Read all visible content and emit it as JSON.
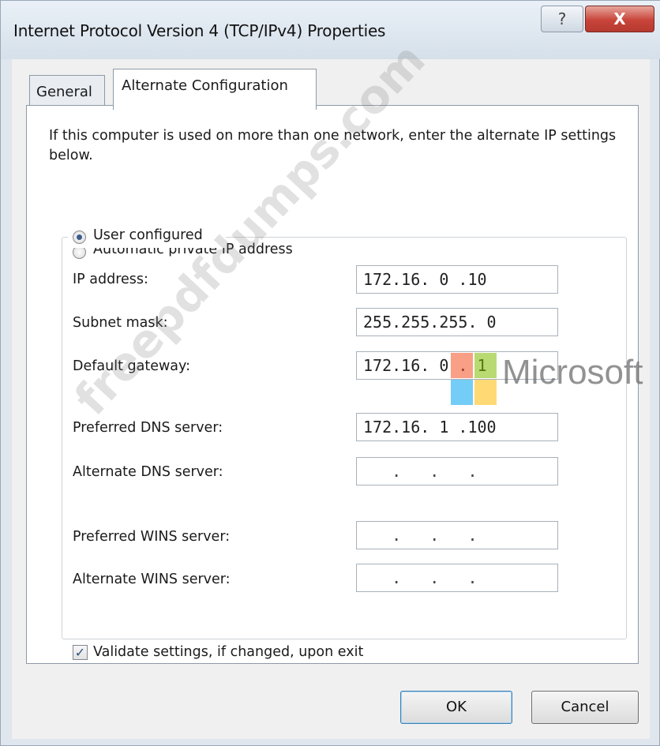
{
  "window": {
    "title": "Internet Protocol Version 4 (TCP/IPv4) Properties",
    "help_label": "?",
    "close_label": "X"
  },
  "tabs": [
    {
      "label": "General"
    },
    {
      "label": "Alternate Configuration"
    }
  ],
  "panel": {
    "intro": "If this computer is used on more than one network, enter the alternate IP settings below.",
    "radio_auto": "Automatic private IP address",
    "radio_user": "User configured",
    "selected": "User configured",
    "fields": {
      "ip_label": "IP address:",
      "ip_value": "172.16. 0 .10",
      "subnet_label": "Subnet mask:",
      "subnet_value": "255.255.255. 0",
      "gateway_label": "Default gateway:",
      "gateway_value": "172.16. 0 . 1",
      "pdns_label": "Preferred DNS server:",
      "pdns_value": "172.16. 1 .100",
      "adns_label": "Alternate DNS server:",
      "adns_value": "   .   .   .",
      "pwins_label": "Preferred WINS server:",
      "pwins_value": "   .   .   .",
      "awins_label": "Alternate WINS server:",
      "awins_value": "   .   .   ."
    },
    "validate_label": "Validate settings, if changed, upon exit",
    "validate_checked": true
  },
  "buttons": {
    "ok": "OK",
    "cancel": "Cancel"
  },
  "watermark": {
    "text": "freepdfdumps.com",
    "brand": "Microsoft",
    "logo_colors": [
      "#f25022",
      "#7fba00",
      "#00a4ef",
      "#ffb900"
    ]
  }
}
